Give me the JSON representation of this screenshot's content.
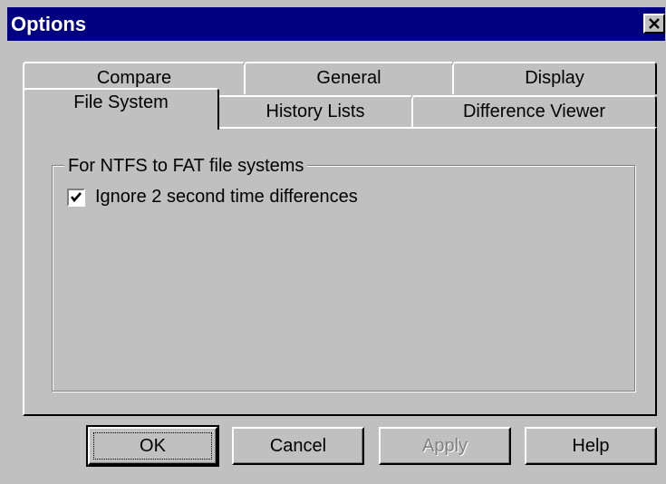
{
  "window": {
    "title": "Options",
    "close_icon": "close-icon"
  },
  "tabs": {
    "back_row": [
      "Compare",
      "General",
      "Display"
    ],
    "front_row": [
      "File System",
      "History Lists",
      "Difference Viewer"
    ],
    "active": "File System"
  },
  "panel": {
    "group_label": "For NTFS to FAT file systems",
    "checkbox": {
      "label": "Ignore 2 second time differences",
      "checked": true
    }
  },
  "buttons": {
    "ok": "OK",
    "cancel": "Cancel",
    "apply": "Apply",
    "help": "Help",
    "apply_disabled": true
  },
  "colors": {
    "titlebar": "#000080",
    "face": "#c0c0c0",
    "disabled_text": "#808080"
  }
}
